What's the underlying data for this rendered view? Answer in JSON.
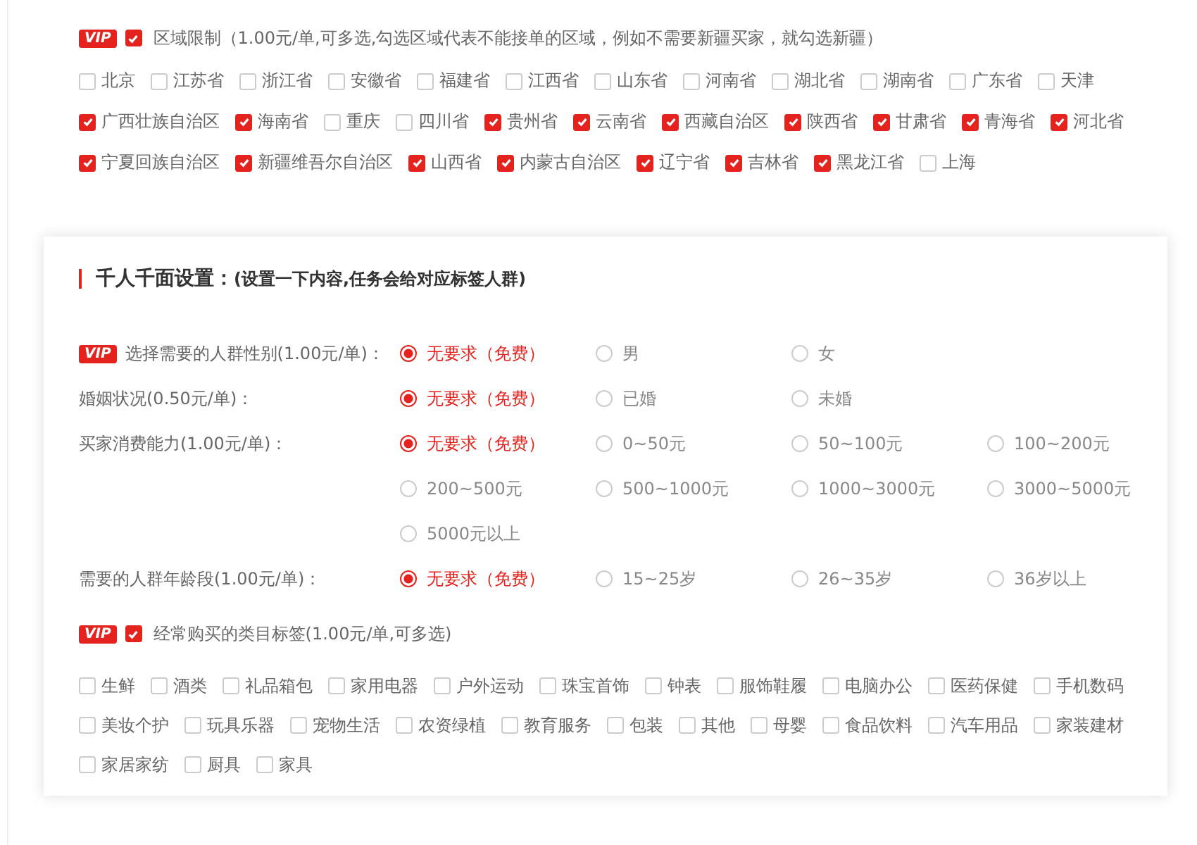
{
  "region": {
    "badge": "VIP",
    "checked": true,
    "label": "区域限制（1.00元/单,可多选,勾选区域代表不能接单的区域，例如不需要新疆买家，就勾选新疆）",
    "options": [
      {
        "label": "北京",
        "checked": false
      },
      {
        "label": "江苏省",
        "checked": false
      },
      {
        "label": "浙江省",
        "checked": false
      },
      {
        "label": "安徽省",
        "checked": false
      },
      {
        "label": "福建省",
        "checked": false
      },
      {
        "label": "江西省",
        "checked": false
      },
      {
        "label": "山东省",
        "checked": false
      },
      {
        "label": "河南省",
        "checked": false
      },
      {
        "label": "湖北省",
        "checked": false
      },
      {
        "label": "湖南省",
        "checked": false
      },
      {
        "label": "广东省",
        "checked": false
      },
      {
        "label": "天津",
        "checked": false
      },
      {
        "label": "广西壮族自治区",
        "checked": true
      },
      {
        "label": "海南省",
        "checked": true
      },
      {
        "label": "重庆",
        "checked": false
      },
      {
        "label": "四川省",
        "checked": false
      },
      {
        "label": "贵州省",
        "checked": true
      },
      {
        "label": "云南省",
        "checked": true
      },
      {
        "label": "西藏自治区",
        "checked": true
      },
      {
        "label": "陕西省",
        "checked": true
      },
      {
        "label": "甘肃省",
        "checked": true
      },
      {
        "label": "青海省",
        "checked": true
      },
      {
        "label": "河北省",
        "checked": true
      },
      {
        "label": "宁夏回族自治区",
        "checked": true
      },
      {
        "label": "新疆维吾尔自治区",
        "checked": true
      },
      {
        "label": "山西省",
        "checked": true
      },
      {
        "label": "内蒙古自治区",
        "checked": true
      },
      {
        "label": "辽宁省",
        "checked": true
      },
      {
        "label": "吉林省",
        "checked": true
      },
      {
        "label": "黑龙江省",
        "checked": true
      },
      {
        "label": "上海",
        "checked": false
      }
    ]
  },
  "panel": {
    "title": "千人千面设置：",
    "subtitle": "(设置一下内容,任务会给对应标签人群)",
    "questions": [
      {
        "badge": "VIP",
        "label": "选择需要的人群性别(1.00元/单)：",
        "options": [
          {
            "label": "无要求（免费）",
            "selected": true
          },
          {
            "label": "男",
            "selected": false
          },
          {
            "label": "女",
            "selected": false
          }
        ]
      },
      {
        "label": "婚姻状况(0.50元/单)：",
        "options": [
          {
            "label": "无要求（免费）",
            "selected": true
          },
          {
            "label": "已婚",
            "selected": false
          },
          {
            "label": "未婚",
            "selected": false
          }
        ]
      },
      {
        "label": "买家消费能力(1.00元/单)：",
        "options": [
          {
            "label": "无要求（免费）",
            "selected": true
          },
          {
            "label": "0~50元",
            "selected": false
          },
          {
            "label": "50~100元",
            "selected": false
          },
          {
            "label": "100~200元",
            "selected": false
          },
          {
            "label": "200~500元",
            "selected": false
          },
          {
            "label": "500~1000元",
            "selected": false
          },
          {
            "label": "1000~3000元",
            "selected": false
          },
          {
            "label": "3000~5000元",
            "selected": false
          },
          {
            "label": "5000元以上",
            "selected": false
          }
        ]
      },
      {
        "label": "需要的人群年龄段(1.00元/单)：",
        "options": [
          {
            "label": "无要求（免费）",
            "selected": true
          },
          {
            "label": "15~25岁",
            "selected": false
          },
          {
            "label": "26~35岁",
            "selected": false
          },
          {
            "label": "36岁以上",
            "selected": false
          }
        ]
      }
    ],
    "category": {
      "badge": "VIP",
      "checked": true,
      "label": "经常购买的类目标签(1.00元/单,可多选)",
      "options": [
        {
          "label": "生鲜",
          "checked": false
        },
        {
          "label": "酒类",
          "checked": false
        },
        {
          "label": "礼品箱包",
          "checked": false
        },
        {
          "label": "家用电器",
          "checked": false
        },
        {
          "label": "户外运动",
          "checked": false
        },
        {
          "label": "珠宝首饰",
          "checked": false
        },
        {
          "label": "钟表",
          "checked": false
        },
        {
          "label": "服饰鞋履",
          "checked": false
        },
        {
          "label": "电脑办公",
          "checked": false
        },
        {
          "label": "医药保健",
          "checked": false
        },
        {
          "label": "手机数码",
          "checked": false
        },
        {
          "label": "美妆个护",
          "checked": false
        },
        {
          "label": "玩具乐器",
          "checked": false
        },
        {
          "label": "宠物生活",
          "checked": false
        },
        {
          "label": "农资绿植",
          "checked": false
        },
        {
          "label": "教育服务",
          "checked": false
        },
        {
          "label": "包装",
          "checked": false
        },
        {
          "label": "其他",
          "checked": false
        },
        {
          "label": "母婴",
          "checked": false
        },
        {
          "label": "食品饮料",
          "checked": false
        },
        {
          "label": "汽车用品",
          "checked": false
        },
        {
          "label": "家装建材",
          "checked": false
        },
        {
          "label": "家居家纺",
          "checked": false
        },
        {
          "label": "厨具",
          "checked": false
        },
        {
          "label": "家具",
          "checked": false
        }
      ]
    }
  }
}
